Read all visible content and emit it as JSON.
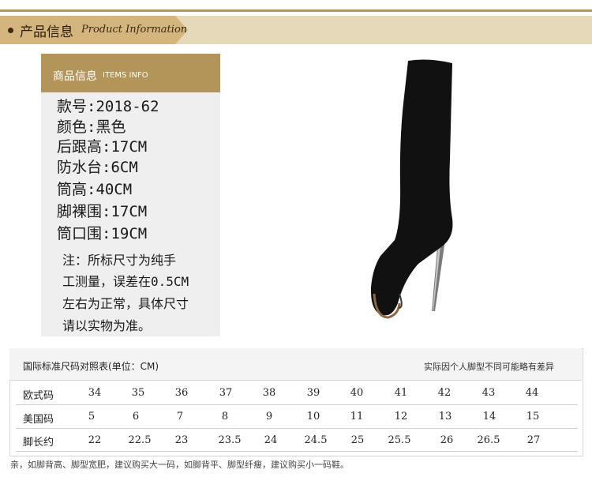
{
  "banner": {
    "title_cn": "产品信息",
    "title_en": "Product Information"
  },
  "info": {
    "header_cn": "商品信息",
    "header_en": "ITEMS INFO",
    "specs": [
      "款号:2018-62",
      "颜色:黑色",
      "后跟高:17CM",
      "防水台:6CM",
      "筒高:40CM",
      "脚裸围:17CM",
      "筒口围:19CM"
    ],
    "note_lines": [
      "注：所标尺寸为纯手",
      "工测量，误差在0.5CM",
      "左右为正常，具体尺寸",
      "请以实物为准。"
    ]
  },
  "size_table": {
    "title": "国际标准尺码对照表(单位：CM)",
    "note": "实际因个人脚型不同可能略有差异",
    "rows": [
      {
        "label": "欧式码",
        "values": [
          "34",
          "35",
          "36",
          "37",
          "38",
          "39",
          "40",
          "41",
          "42",
          "43",
          "44"
        ]
      },
      {
        "label": "美国码",
        "values": [
          "5",
          "6",
          "7",
          "8",
          "9",
          "10",
          "11",
          "12",
          "13",
          "14",
          "15"
        ]
      },
      {
        "label": "脚长约",
        "values": [
          "22",
          "22.5",
          "23",
          "23.5",
          "24",
          "24.5",
          "25",
          "25.5",
          "26",
          "26.5",
          "27"
        ]
      }
    ]
  },
  "footer": "亲，如脚背高、脚型宽肥，建议购买大一码，如脚背平、脚型纤瘦，建议购买小一码鞋。",
  "colors": {
    "accent": "#b39559",
    "banner_light": "#e6d9b9",
    "banner_tab": "#d4b57e"
  }
}
